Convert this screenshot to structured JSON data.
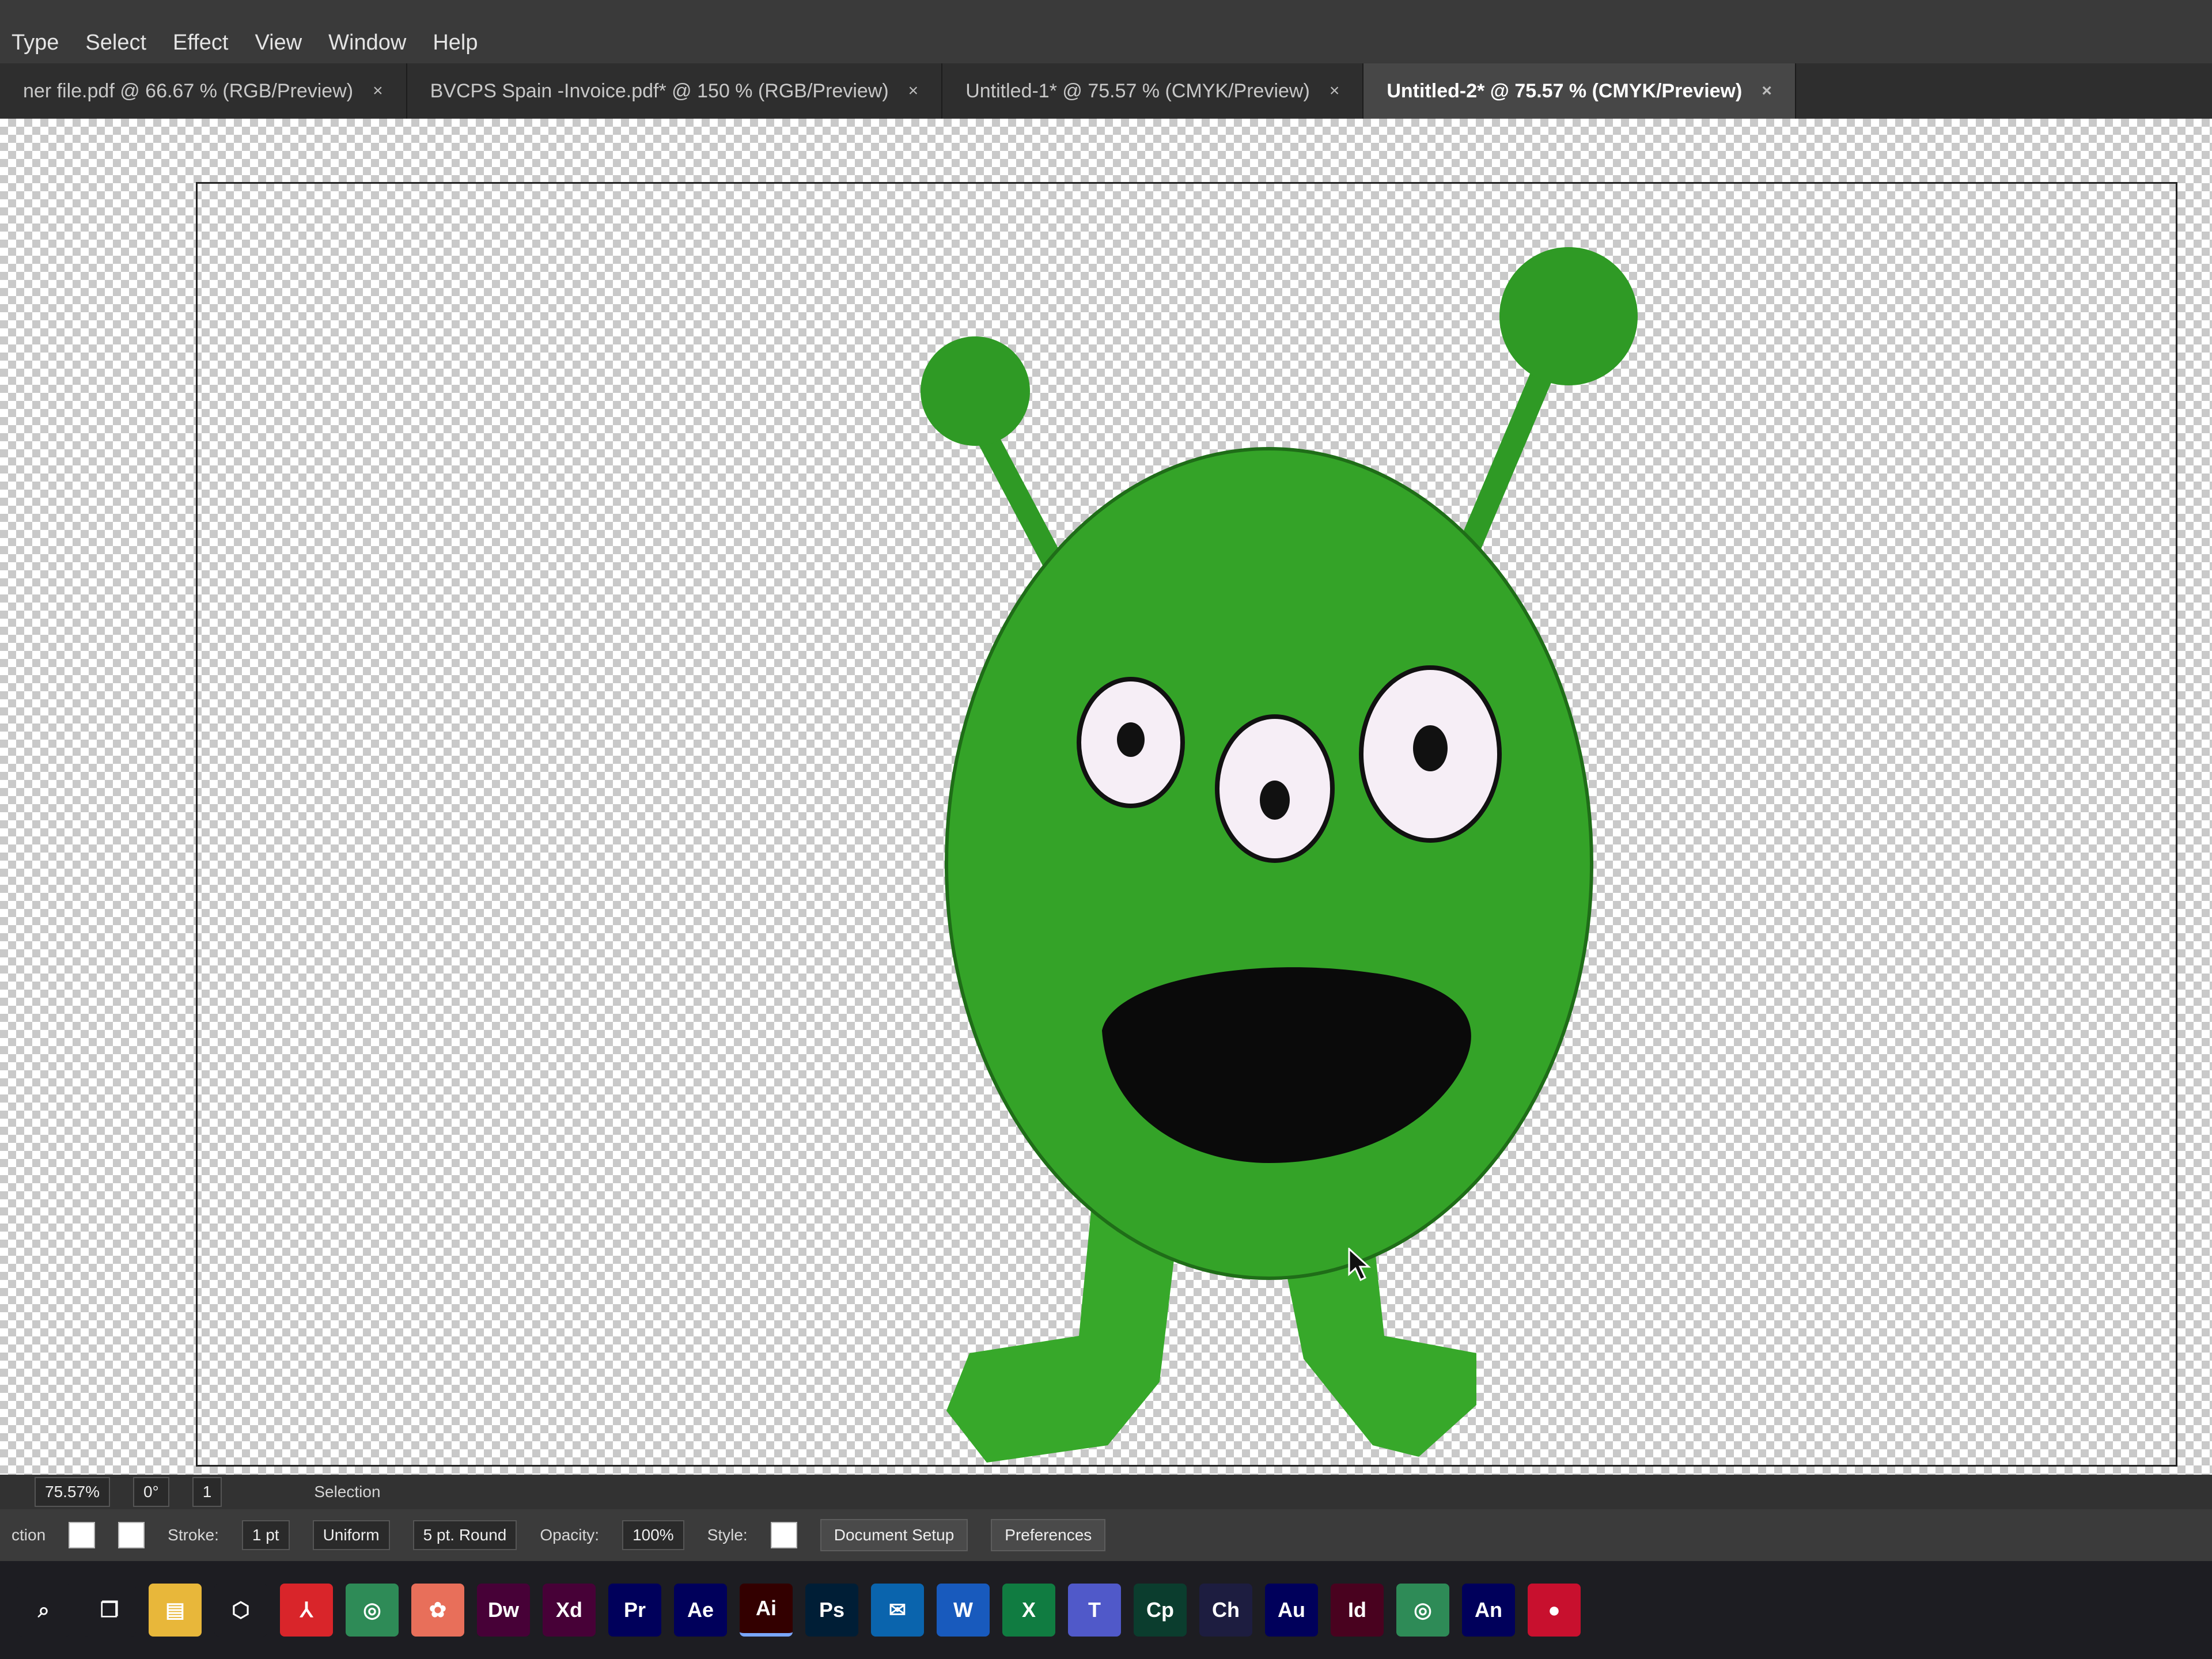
{
  "menu": [
    "Type",
    "Select",
    "Effect",
    "View",
    "Window",
    "Help"
  ],
  "tabs": [
    {
      "label": "ner file.pdf @ 66.67 % (RGB/Preview)",
      "active": false
    },
    {
      "label": "BVCPS Spain -Invoice.pdf* @ 150 % (RGB/Preview)",
      "active": false
    },
    {
      "label": "Untitled-1* @ 75.57 % (CMYK/Preview)",
      "active": false
    },
    {
      "label": "Untitled-2* @ 75.57 % (CMYK/Preview)",
      "active": true
    }
  ],
  "tab_close_glyph": "×",
  "statusbar": {
    "zoom": "75.57%",
    "rotation": "0°",
    "artboard_index": "1",
    "tool": "Selection"
  },
  "controlbar": {
    "left_label": "ction",
    "stroke_label": "Stroke:",
    "stroke_value": "1 pt",
    "profile_label": "Uniform",
    "brush_label": "5 pt. Round",
    "opacity_label": "Opacity:",
    "opacity_value": "100%",
    "style_label": "Style:",
    "document_setup": "Document Setup",
    "preferences": "Preferences"
  },
  "taskbar": [
    {
      "name": "search-icon",
      "glyph": "⌕",
      "color": "#1d1d22"
    },
    {
      "name": "task-view-icon",
      "glyph": "❐",
      "color": "#1d1d22"
    },
    {
      "name": "file-explorer-icon",
      "glyph": "▤",
      "color": "#e8b73a"
    },
    {
      "name": "creative-cloud-icon",
      "glyph": "⬡",
      "color": "#1d1d22"
    },
    {
      "name": "acrobat-icon",
      "glyph": "⅄",
      "color": "#d9252a"
    },
    {
      "name": "chrome-icon",
      "glyph": "◎",
      "color": "#2e8b57"
    },
    {
      "name": "photos-icon",
      "glyph": "✿",
      "color": "#e86f5a"
    },
    {
      "name": "dreamweaver-icon",
      "glyph": "Dw",
      "color": "#470137"
    },
    {
      "name": "xd-icon",
      "glyph": "Xd",
      "color": "#470137"
    },
    {
      "name": "premiere-icon",
      "glyph": "Pr",
      "color": "#00005b"
    },
    {
      "name": "after-effects-icon",
      "glyph": "Ae",
      "color": "#00005b"
    },
    {
      "name": "illustrator-icon",
      "glyph": "Ai",
      "color": "#330000"
    },
    {
      "name": "photoshop-icon",
      "glyph": "Ps",
      "color": "#001e36"
    },
    {
      "name": "outlook-icon",
      "glyph": "✉",
      "color": "#0a64ad"
    },
    {
      "name": "word-icon",
      "glyph": "W",
      "color": "#185abd"
    },
    {
      "name": "excel-icon",
      "glyph": "X",
      "color": "#107c41"
    },
    {
      "name": "teams-icon",
      "glyph": "T",
      "color": "#5059c9"
    },
    {
      "name": "captivate-icon",
      "glyph": "Cp",
      "color": "#0b3d2e"
    },
    {
      "name": "character-animator-icon",
      "glyph": "Ch",
      "color": "#1d1d40"
    },
    {
      "name": "audition-icon",
      "glyph": "Au",
      "color": "#00005b"
    },
    {
      "name": "indesign-icon",
      "glyph": "Id",
      "color": "#49021f"
    },
    {
      "name": "chrome-profile-icon",
      "glyph": "◎",
      "color": "#2e8b57"
    },
    {
      "name": "animate-icon",
      "glyph": "An",
      "color": "#00005b"
    },
    {
      "name": "record-icon",
      "glyph": "●",
      "color": "#c8102e"
    }
  ],
  "colors": {
    "alien_green": "#36a52a",
    "alien_dark": "#1f7a1a",
    "eye_white": "#f6eef6",
    "pupil": "#111111"
  }
}
